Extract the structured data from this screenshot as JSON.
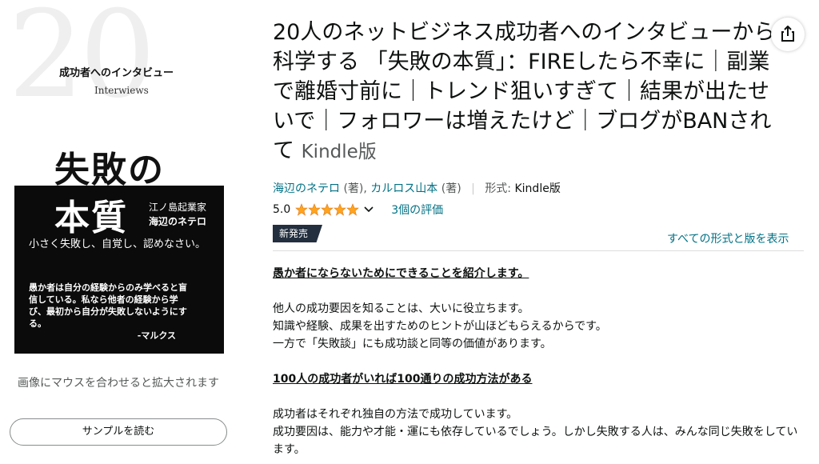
{
  "cover": {
    "big_number": "20",
    "series": "成功者へのインタビュー",
    "series_en": "Interwiews",
    "title_line1": "失敗の",
    "title_line2": "本質",
    "author_role": "江ノ島起業家",
    "author_name": "海辺のネテロ",
    "slogan": "小さく失敗し、自覚し、認めなさい。",
    "quote": "愚か者は自分の経験からのみ学べると盲信している。私なら他者の経験から学び、最初から自分が失敗しないようにする。",
    "quote_attr": "-マルクス"
  },
  "hover_hint": "画像にマウスを合わせると拡大されます",
  "sample_button": "サンプルを読む",
  "product": {
    "title": "20人のネットビジネス成功者へのインタビューから科学する 「失敗の本質」：FIREしたら不幸に｜副業で離婚寸前に｜トレンド狙いすぎて｜結果が出たせいで｜フォロワーは増えたけど｜ブログがBANされて",
    "format_tag": "Kindle版",
    "author1": "海辺のネテロ",
    "author1_role": "(著)",
    "comma": ",",
    "author2": "カルロス山本",
    "author2_role": "(著)",
    "format_label": "形式:",
    "format_value": "Kindle版",
    "rating": "5.0",
    "rating_value": 5.0,
    "rating_count": "3個の評価",
    "new_badge": "新発売",
    "all_formats_link": "すべての形式と版を表示"
  },
  "description": {
    "heading1": "愚か者にならないためにできることを紹介します。",
    "p1": "他人の成功要因を知ることは、大いに役立ちます。",
    "p2": "知識や経験、成果を出すためのヒントが山ほどもらえるからです。",
    "p3": "一方で「失敗談」にも成功談と同等の価値があります。",
    "heading2": "100人の成功者がいれば100通りの成功方法がある",
    "p4": "成功者はそれぞれ独自の方法で成功しています。",
    "p5": "成功要因は、能力や才能・運にも依存しているでしょう。しかし失敗する人は、みんな同じ失敗をしています。"
  },
  "colors": {
    "link": "#007185",
    "star": "#ffa41c",
    "badge": "#232f3e"
  },
  "icons": {
    "share": "share-icon",
    "star": "star-icon",
    "chevron": "chevron-down-icon"
  }
}
